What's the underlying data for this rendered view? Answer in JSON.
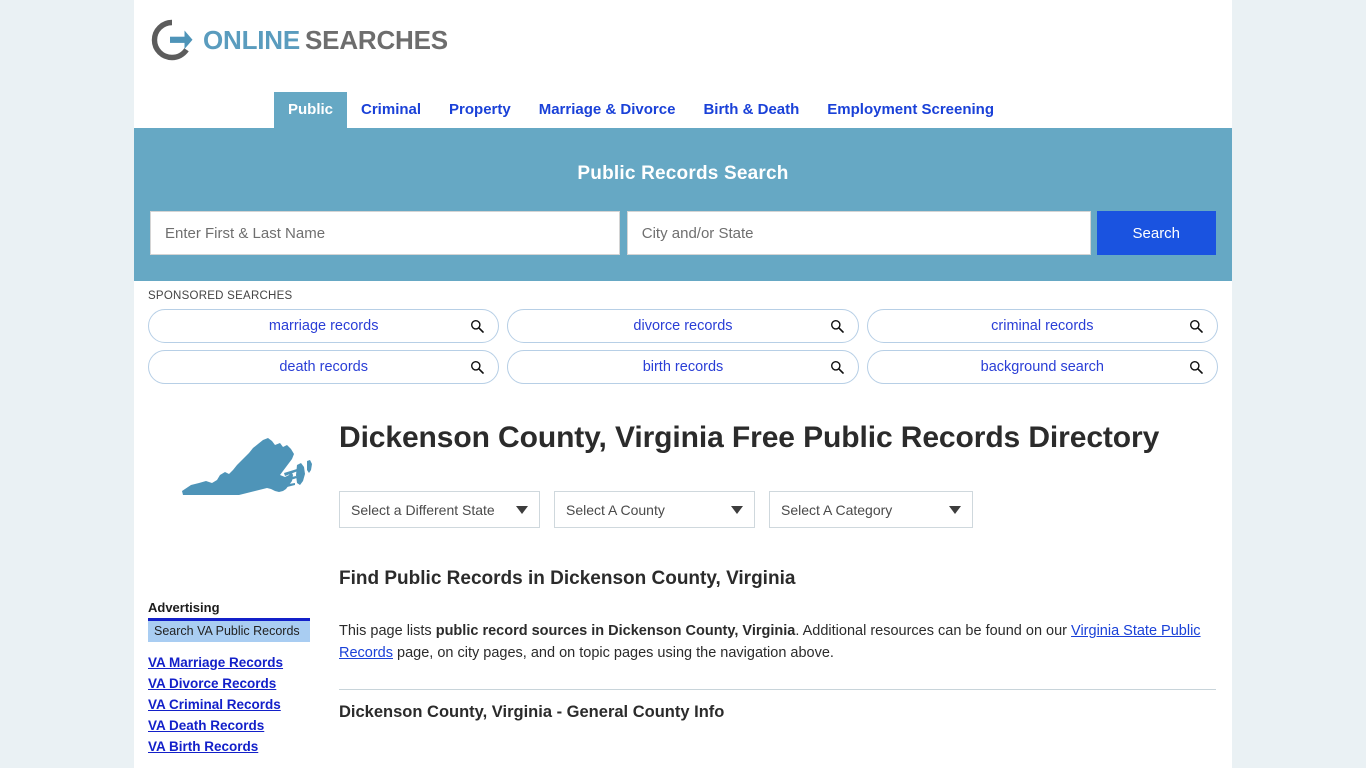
{
  "brand": {
    "logo_icon": "circle-arrow-logo-icon",
    "name_part1": "ONLINE",
    "name_part2": "SEARCHES",
    "color_primary": "#5a9cbe",
    "color_secondary": "#6d6d6d"
  },
  "nav": {
    "tabs": [
      {
        "label": "Public",
        "active": true
      },
      {
        "label": "Criminal",
        "active": false
      },
      {
        "label": "Property",
        "active": false
      },
      {
        "label": "Marriage & Divorce",
        "active": false
      },
      {
        "label": "Birth & Death",
        "active": false
      },
      {
        "label": "Employment Screening",
        "active": false
      }
    ]
  },
  "search": {
    "title": "Public Records Search",
    "name_placeholder": "Enter First & Last Name",
    "name_value": "",
    "city_placeholder": "City and/or State",
    "city_value": "",
    "submit_label": "Search",
    "band_color": "#66a8c4",
    "button_color": "#1a53e0"
  },
  "sponsored": {
    "label": "SPONSORED SEARCHES",
    "pills": [
      "marriage records",
      "divorce records",
      "criminal records",
      "death records",
      "birth records",
      "background search"
    ],
    "icon": "magnifier-icon"
  },
  "page": {
    "map_icon": "virginia-state-map-icon",
    "title": "Dickenson County, Virginia Free Public Records Directory",
    "selectors": [
      {
        "label": "Select a Different State"
      },
      {
        "label": "Select A County"
      },
      {
        "label": "Select A Category"
      }
    ],
    "section_heading": "Find Public Records in Dickenson County, Virginia",
    "intro": {
      "text_1": "This page lists ",
      "bold_1": "public record sources in Dickenson County, Virginia",
      "text_2": ". Additional resources can be found on our ",
      "link_1": "Virginia State Public Records",
      "text_3": " page, on city pages, and on topic pages using the navigation above."
    },
    "subsection_heading": "Dickenson County, Virginia - General County Info"
  },
  "sidebar": {
    "advertising_label": "Advertising",
    "ad_header": "Search VA Public Records",
    "links": [
      "VA Marriage Records",
      "VA Divorce Records",
      "VA Criminal Records",
      "VA Death Records",
      "VA Birth Records"
    ]
  }
}
